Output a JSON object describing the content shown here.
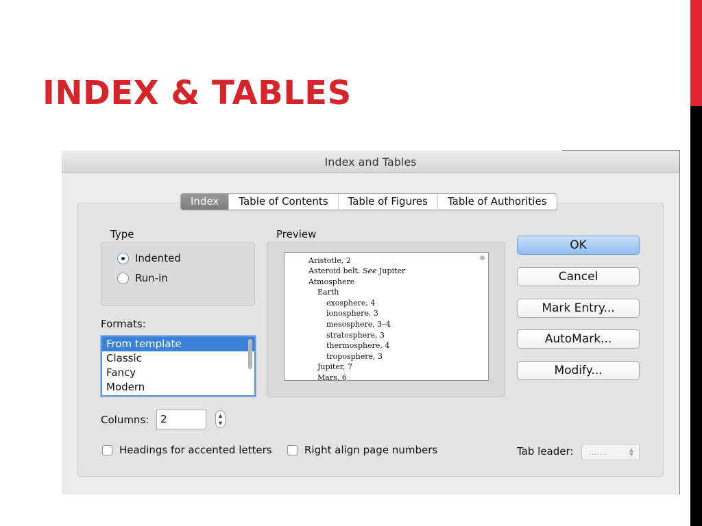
{
  "slide": {
    "title": "INDEX & TABLES",
    "accent_color": "#d5252a"
  },
  "dialog": {
    "title": "Index and Tables",
    "tabs": [
      {
        "label": "Index",
        "active": true
      },
      {
        "label": "Table of Contents",
        "active": false
      },
      {
        "label": "Table of Figures",
        "active": false
      },
      {
        "label": "Table of Authorities",
        "active": false
      }
    ],
    "type": {
      "label": "Type",
      "options": [
        {
          "label": "Indented",
          "selected": true
        },
        {
          "label": "Run-in",
          "selected": false
        }
      ]
    },
    "formats": {
      "label": "Formats:",
      "items": [
        "From template",
        "Classic",
        "Fancy",
        "Modern"
      ],
      "selected": "From template"
    },
    "preview": {
      "label": "Preview",
      "lines": [
        {
          "text": "Aristotle, 2",
          "indent": 0
        },
        {
          "text": "Asteroid belt.",
          "see": "See",
          "see_target": "Jupiter",
          "indent": 0
        },
        {
          "text": "Atmosphere",
          "indent": 0
        },
        {
          "text": "Earth",
          "indent": 1
        },
        {
          "text": "exosphere, 4",
          "indent": 2
        },
        {
          "text": "ionosphere, 3",
          "indent": 2
        },
        {
          "text": "mesosphere, 3–4",
          "indent": 2
        },
        {
          "text": "stratosphere, 3",
          "indent": 2
        },
        {
          "text": "thermosphere, 4",
          "indent": 2
        },
        {
          "text": "troposphere, 3",
          "indent": 2
        },
        {
          "text": "Jupiter, 7",
          "indent": 1
        },
        {
          "text": "Mars, 6",
          "indent": 1
        }
      ]
    },
    "buttons": {
      "ok": "OK",
      "cancel": "Cancel",
      "mark_entry": "Mark Entry...",
      "automark": "AutoMark...",
      "modify": "Modify..."
    },
    "columns": {
      "label": "Columns:",
      "value": "2"
    },
    "headings_accented": {
      "label": "Headings for accented letters",
      "checked": false
    },
    "right_align": {
      "label": "Right align page numbers",
      "checked": false
    },
    "tab_leader": {
      "label": "Tab leader:",
      "value": ".......",
      "enabled": false
    }
  }
}
